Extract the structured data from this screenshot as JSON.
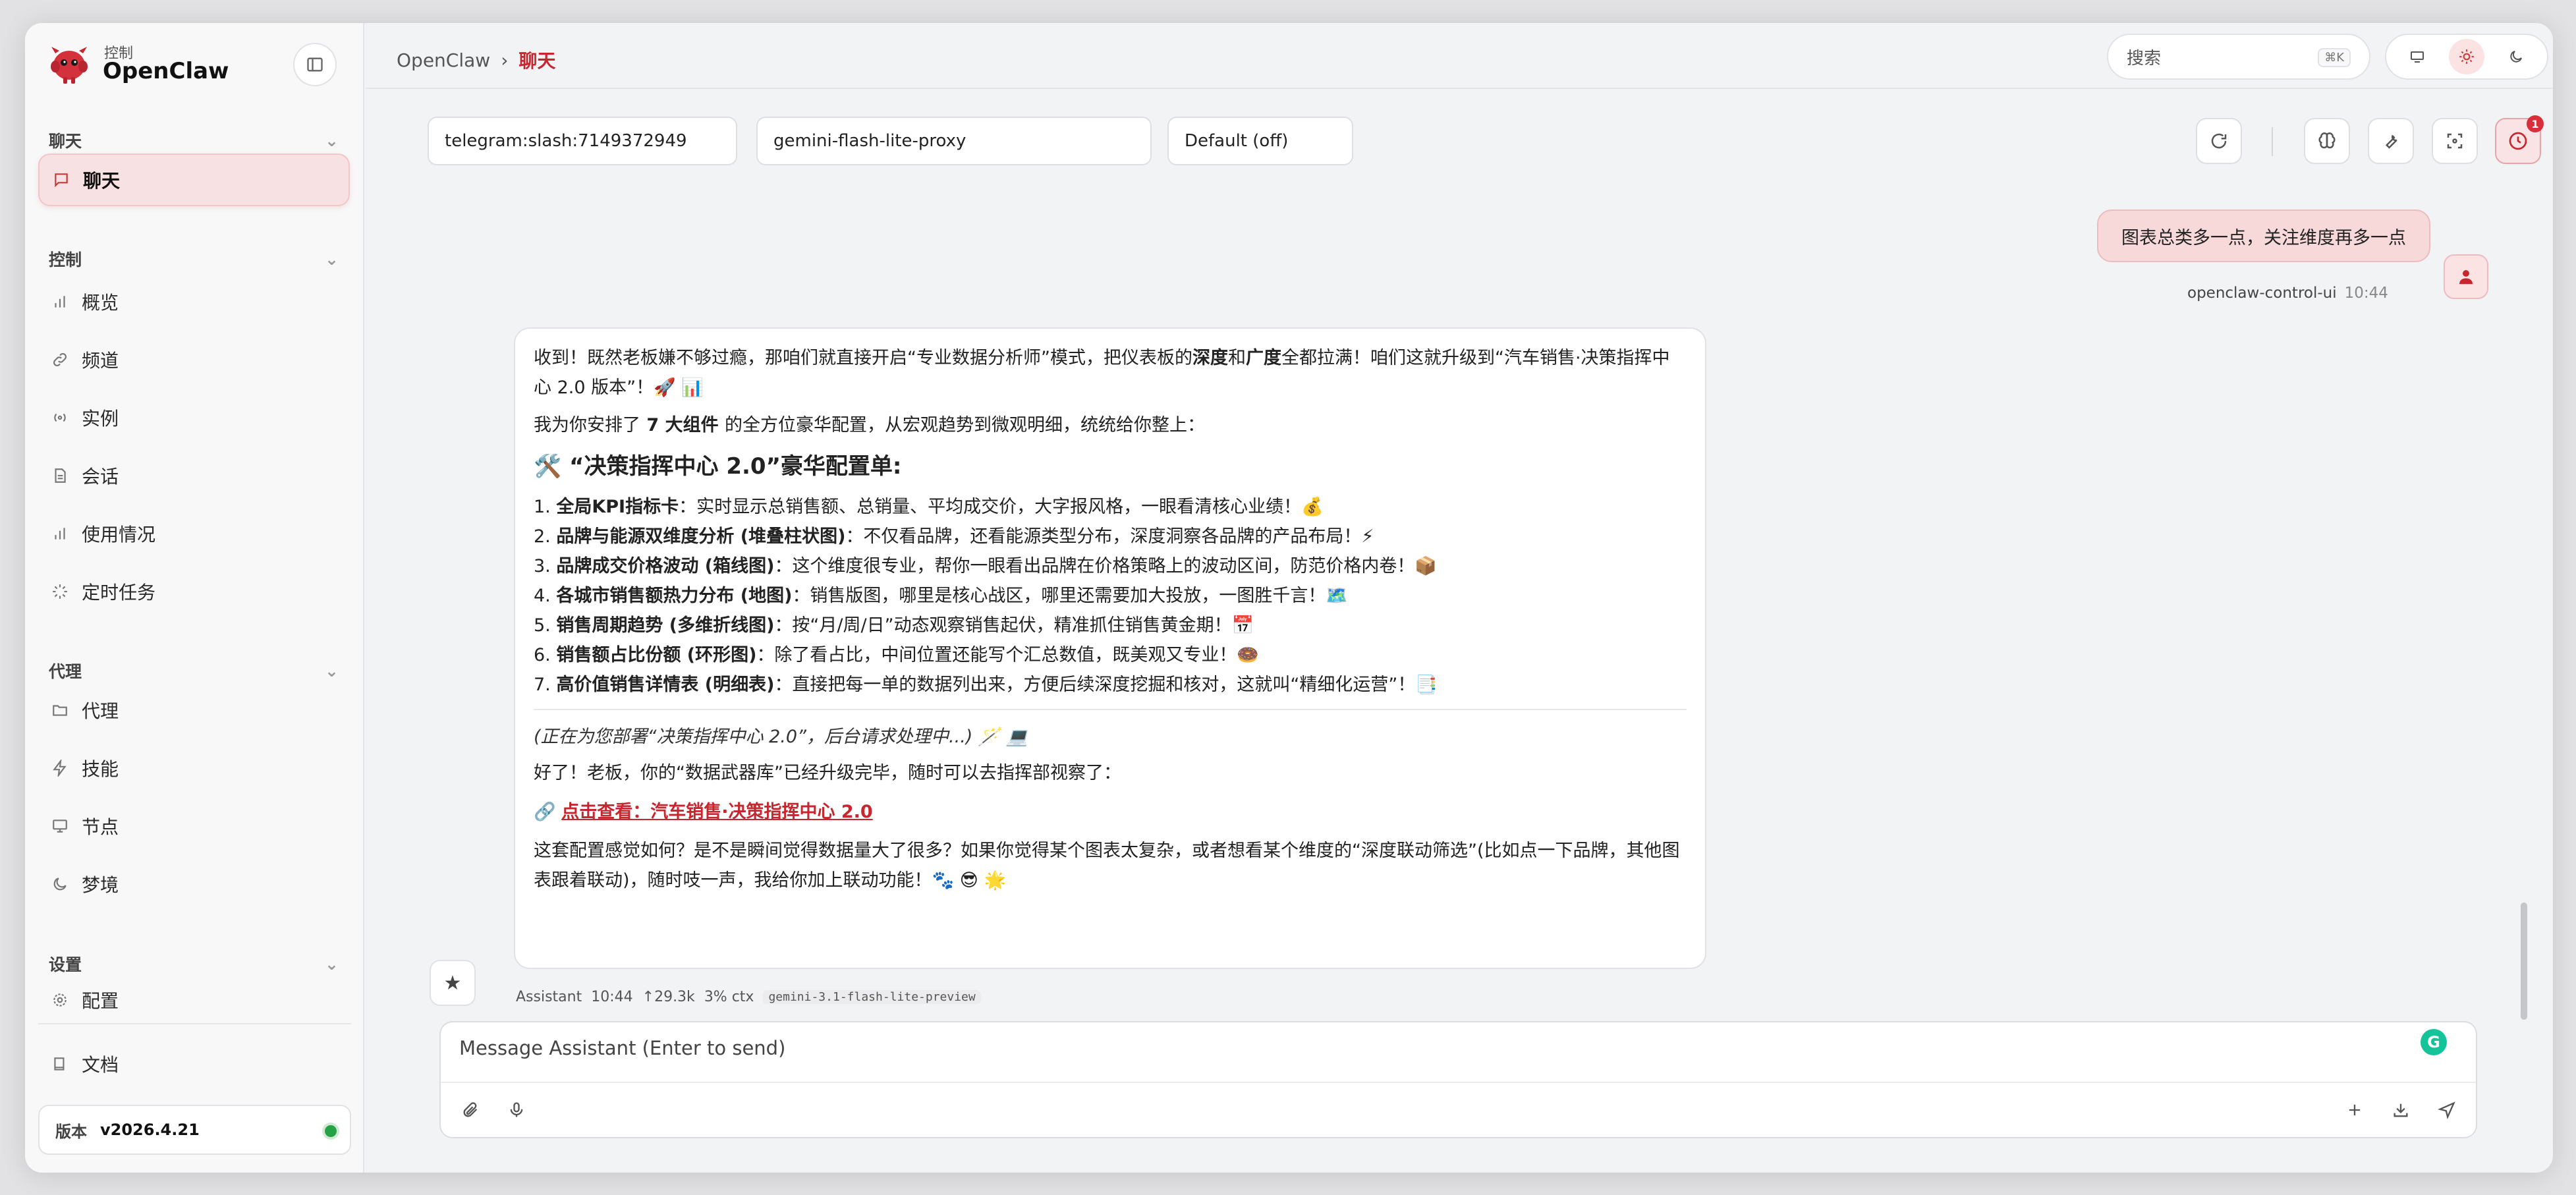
{
  "sidebar": {
    "brand_sub": "控制",
    "brand_name": "OpenClaw",
    "sections": {
      "chat": "聊天",
      "control": "控制",
      "agent": "代理",
      "settings": "设置"
    },
    "items": {
      "chat": "聊天",
      "overview": "概览",
      "channels": "频道",
      "instances": "实例",
      "sessions": "会话",
      "usage": "使用情况",
      "cron": "定时任务",
      "agents": "代理",
      "skills": "技能",
      "nodes": "节点",
      "dreams": "梦境",
      "config": "配置",
      "docs": "文档"
    },
    "version_label": "版本",
    "version_value": "v2026.4.21"
  },
  "header": {
    "breadcrumb_root": "OpenClaw",
    "breadcrumb_sep": "›",
    "breadcrumb_current": "聊天",
    "search_placeholder": "搜索",
    "search_shortcut": "⌘K"
  },
  "chat_toolbar": {
    "session": "telegram:slash:7149372949",
    "model": "gemini-flash-lite-proxy",
    "thinking": "Default (off)",
    "cron_badge": "1"
  },
  "user_message": {
    "text": "图表总类多一点，关注维度再多一点",
    "sender": "openclaw-control-ui",
    "time": "10:44"
  },
  "assistant_message": {
    "intro_a": "收到！既然老板嫌不够过瘾，那咱们就直接开启“专业数据分析师”模式，把仪表板的",
    "intro_b1": "深度",
    "intro_b2": "和",
    "intro_b3": "广度",
    "intro_c": "全都拉满！咱们这就升级到“汽车销售·决策指挥中心 2.0 版本”！🚀 📊",
    "plan_a": "我为你安排了",
    "plan_b": " 7 大组件 ",
    "plan_c": "的全方位豪华配置，从宏观趋势到微观明细，统统给你整上：",
    "heading": "🛠️ “决策指挥中心 2.0”豪华配置单:",
    "list": [
      {
        "num": "1. ",
        "title": "全局KPI指标卡",
        "desc": "：实时显示总销售额、总销量、平均成交价，大字报风格，一眼看清核心业绩！💰"
      },
      {
        "num": "2. ",
        "title": "品牌与能源双维度分析 (堆叠柱状图)",
        "desc": "：不仅看品牌，还看能源类型分布，深度洞察各品牌的产品布局！⚡"
      },
      {
        "num": "3. ",
        "title": "品牌成交价格波动 (箱线图)",
        "desc": "：这个维度很专业，帮你一眼看出品牌在价格策略上的波动区间，防范价格内卷！📦"
      },
      {
        "num": "4. ",
        "title": "各城市销售额热力分布 (地图)",
        "desc": "：销售版图，哪里是核心战区，哪里还需要加大投放，一图胜千言！🗺️"
      },
      {
        "num": "5. ",
        "title": "销售周期趋势 (多维折线图)",
        "desc": "：按“月/周/日”动态观察销售起伏，精准抓住销售黄金期！📅"
      },
      {
        "num": "6. ",
        "title": "销售额占比份额 (环形图)",
        "desc": "：除了看占比，中间位置还能写个汇总数值，既美观又专业！🍩"
      },
      {
        "num": "7. ",
        "title": "高价值销售详情表 (明细表)",
        "desc": "：直接把每一单的数据列出来，方便后续深度挖掘和核对，这就叫“精细化运营”！📑"
      }
    ],
    "deploying": "(正在为您部署“决策指挥中心 2.0”，后台请求处理中...) 🪄 💻",
    "done": "好了！老板，你的“数据武器库”已经升级完毕，随时可以去指挥部视察了：",
    "link_prefix": "🔗 ",
    "link": "点击查看：汽车销售·决策指挥中心 2.0",
    "closing": "这套配置感觉如何？是不是瞬间觉得数据量大了很多？如果你觉得某个图表太复杂，或者想看某个维度的“深度联动筛选”(比如点一下品牌，其他图表跟着联动)，随时吱一声，我给你加上联动功能！🐾 😎 🌟",
    "sender": "Assistant",
    "time": "10:44",
    "tokens": "↑29.3k",
    "ctx": "3% ctx",
    "model": "gemini-3.1-flash-lite-preview"
  },
  "composer": {
    "placeholder": "Message Assistant (Enter to send)"
  },
  "colors": {
    "accent": "#c8262f",
    "accent_soft": "#f8e1e2",
    "online": "#25a344"
  }
}
